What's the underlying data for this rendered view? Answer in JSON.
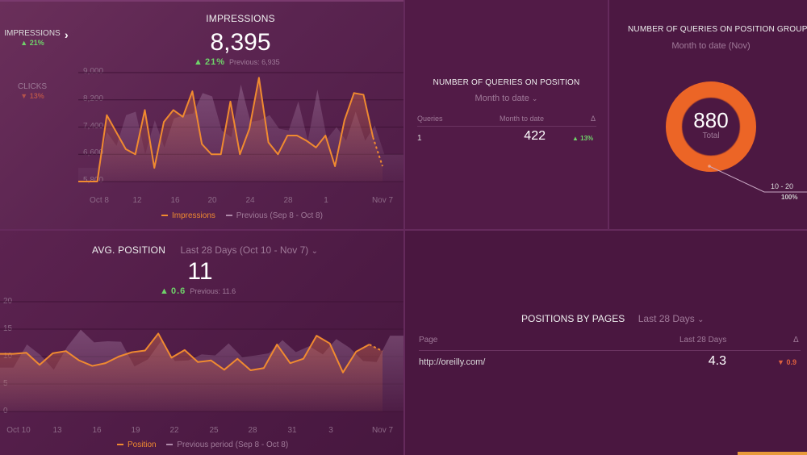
{
  "impressions_panel": {
    "title": "IMPRESSIONS",
    "value": "8,395",
    "delta_arrow": "▲",
    "delta": "21%",
    "previous": "Previous: 6,935",
    "metric_switcher": [
      {
        "label": "IMPRESSIONS",
        "arrow": "▲",
        "delta": "21%",
        "trend": "up"
      },
      {
        "label": "CLICKS",
        "arrow": "▼",
        "delta": "13%",
        "trend": "down"
      }
    ],
    "next_icon": "chevron-right-icon",
    "legend": [
      "Impressions",
      "Previous (Sep 8 - Oct 8)"
    ]
  },
  "queries_position_panel": {
    "title": "NUMBER OF QUERIES ON POSITION",
    "period_dropdown": "Month to date",
    "columns": [
      "Queries",
      "Month to date",
      "Δ"
    ],
    "rows": [
      {
        "query": "1",
        "value": "422",
        "arrow": "▲",
        "delta": "13%"
      }
    ]
  },
  "queries_group_panel": {
    "title": "NUMBER OF QUERIES ON POSITION GROUP",
    "subtitle": "Month to date (Nov)",
    "total": "880",
    "total_label": "Total",
    "slice_label": "10 - 20",
    "slice_pct": "100%"
  },
  "avg_position_panel": {
    "title": "AVG. POSITION",
    "period_dropdown": "Last 28 Days (Oct 10 - Nov 7)",
    "value": "11",
    "delta_arrow": "▲",
    "delta": "0.6",
    "previous": "Previous: 11.6",
    "legend": [
      "Position",
      "Previous period (Sep 8 - Oct 8)"
    ]
  },
  "pages_panel": {
    "title": "POSITIONS BY PAGES",
    "period_dropdown": "Last 28 Days",
    "columns": [
      "Page",
      "Last 28 Days",
      "Δ"
    ],
    "rows": [
      {
        "page": "http://oreilly.com/",
        "value": "4.3",
        "arrow": "▼",
        "delta": "0.9"
      }
    ]
  },
  "colors": {
    "accent": "#f08a30",
    "previous": "#9a6a95",
    "up": "#6fd36a",
    "down": "#d65a4a",
    "donut": "#ec6526"
  },
  "chart_data": [
    {
      "type": "line",
      "title": "Impressions",
      "x_ticks": [
        "Oct 8",
        "12",
        "16",
        "20",
        "24",
        "28",
        "1",
        "Nov 7"
      ],
      "y_ticks": [
        "9,000",
        "8,200",
        "7,400",
        "6,600",
        "5,800"
      ],
      "ylim": [
        5800,
        9000
      ],
      "series": [
        {
          "name": "Impressions",
          "values": [
            5800,
            5800,
            5800,
            7750,
            7250,
            6750,
            6600,
            7900,
            6200,
            7550,
            7900,
            7700,
            8450,
            6900,
            6600,
            6600,
            8150,
            6600,
            7350,
            8850,
            6950,
            6600,
            7150,
            7150,
            7000,
            6800,
            7150,
            6250,
            7600,
            8400,
            8350,
            7100,
            6250
          ]
        },
        {
          "name": "Previous (Sep 8 - Oct 8)",
          "values": [
            6200,
            6200,
            6200,
            7250,
            6850,
            7750,
            7850,
            6600,
            7600,
            6800,
            7650,
            7750,
            7800,
            8400,
            8300,
            7300,
            7100,
            8650,
            7550,
            7600,
            7750,
            7350,
            7300,
            8150,
            7000,
            8500,
            7050,
            7400,
            7000,
            7850,
            7000,
            7450,
            6600,
            6600,
            6600
          ]
        }
      ]
    },
    {
      "type": "line",
      "title": "Avg. Position",
      "x_ticks": [
        "Oct 10",
        "13",
        "16",
        "19",
        "22",
        "25",
        "28",
        "31",
        "3",
        "Nov 7"
      ],
      "y_ticks": [
        "20",
        "15",
        "10",
        "5",
        "0"
      ],
      "ylim": [
        0,
        20
      ],
      "series": [
        {
          "name": "Position",
          "values": [
            10.5,
            10.5,
            10.7,
            8.5,
            10.6,
            11,
            9.3,
            8.3,
            8.8,
            10,
            10.8,
            11.1,
            14.2,
            9.8,
            11.2,
            9,
            9.3,
            7.6,
            9.6,
            7.5,
            7.9,
            12.2,
            8.8,
            9.6,
            13.8,
            12.4,
            7.1,
            10.9,
            12.2,
            11
          ]
        },
        {
          "name": "Previous period (Sep 8 - Oct 8)",
          "values": [
            8,
            8,
            12.2,
            10.3,
            7.6,
            11.8,
            14.9,
            12.6,
            12.8,
            12.7,
            8.2,
            9.5,
            12.9,
            9.2,
            9.3,
            10.4,
            10.2,
            12.4,
            9.9,
            10.2,
            10.6,
            13,
            10.8,
            11.9,
            10.4,
            13.2,
            11.6,
            9.2,
            9,
            13.8,
            13.8
          ]
        }
      ]
    },
    {
      "type": "pie",
      "title": "Number of queries on position group",
      "categories": [
        "10 - 20"
      ],
      "values": [
        880
      ],
      "percent": [
        100
      ]
    }
  ]
}
